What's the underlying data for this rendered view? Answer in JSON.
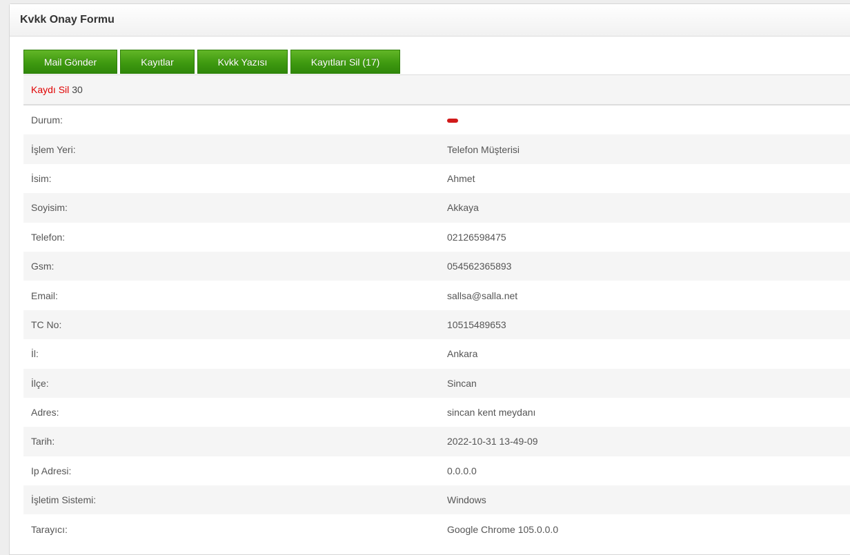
{
  "panel": {
    "title": "Kvkk Onay Formu"
  },
  "toolbar": {
    "buttons": [
      {
        "label": "Mail Gönder"
      },
      {
        "label": "Kayıtlar"
      },
      {
        "label": "Kvkk Yazısı"
      },
      {
        "label": "Kayıtları Sil (17)"
      }
    ]
  },
  "record": {
    "delete_label": "Kaydı Sil",
    "id": "30",
    "status_color": "#d11a1a",
    "fields": [
      {
        "label": "Durum:",
        "value": ""
      },
      {
        "label": "İşlem Yeri:",
        "value": "Telefon Müşterisi"
      },
      {
        "label": "İsim:",
        "value": "Ahmet"
      },
      {
        "label": "Soyisim:",
        "value": "Akkaya"
      },
      {
        "label": "Telefon:",
        "value": "02126598475"
      },
      {
        "label": "Gsm:",
        "value": "054562365893"
      },
      {
        "label": "Email:",
        "value": "sallsa@salla.net"
      },
      {
        "label": "TC No:",
        "value": "10515489653"
      },
      {
        "label": "İl:",
        "value": "Ankara"
      },
      {
        "label": "İlçe:",
        "value": "Sincan"
      },
      {
        "label": "Adres:",
        "value": "sincan kent meydanı"
      },
      {
        "label": "Tarih:",
        "value": "2022-10-31 13-49-09"
      },
      {
        "label": "Ip Adresi:",
        "value": "0.0.0.0"
      },
      {
        "label": "İşletim Sistemi:",
        "value": "Windows"
      },
      {
        "label": "Tarayıcı:",
        "value": "Google Chrome 105.0.0.0"
      }
    ]
  }
}
